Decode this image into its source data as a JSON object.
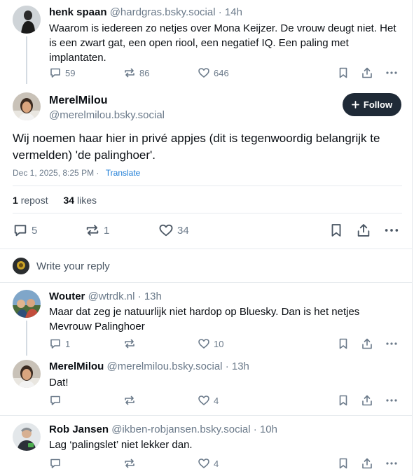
{
  "post1": {
    "name": "henk spaan",
    "handle": "@hardgras.bsky.social",
    "time": "14h",
    "text": "Waarom is iedereen zo netjes over Mona Keijzer. De vrouw deugt niet. Het is een zwart gat, een open riool, een negatief IQ. Een paling met implantaten.",
    "replies": "59",
    "reposts": "86",
    "likes": "646"
  },
  "main": {
    "name": "MerelMilou",
    "handle": "@merelmilou.bsky.social",
    "follow_label": "Follow",
    "text": "Wij noemen haar hier in privé appjes (dit is tegenwoordig belangrijk te vermelden) 'de palinghoer'.",
    "date": "Dec 1, 2025, 8:25 PM",
    "date_sep": "·",
    "translate": "Translate",
    "repost_count": "1",
    "repost_label": "repost",
    "like_count": "34",
    "like_label": "likes",
    "replies": "5",
    "reposts": "1",
    "likes": "34"
  },
  "reply_box": {
    "placeholder": "Write your reply"
  },
  "reply1": {
    "name": "Wouter",
    "handle": "@wtrdk.nl",
    "time": "13h",
    "text": "Maar dat zeg je natuurlijk niet hardop op Bluesky. Dan is het netjes Mevrouw Palinghoer",
    "replies": "1",
    "likes": "10"
  },
  "reply2": {
    "name": "MerelMilou",
    "handle": "@merelmilou.bsky.social",
    "time": "13h",
    "text": "Dat!",
    "likes": "4"
  },
  "reply3": {
    "name": "Rob Jansen",
    "handle": "@ikben-robjansen.bsky.social",
    "time": "10h",
    "text": "Lag ‘palingslet’ niet lekker dan.",
    "likes": "4"
  },
  "colors": {
    "accent": "#1c7cd6",
    "muted": "#6b7a8a",
    "follow_bg": "#1f2a37",
    "divider": "#e6eaee"
  },
  "icons": [
    "reply-icon",
    "repost-icon",
    "like-icon",
    "bookmark-icon",
    "share-icon",
    "more-icon",
    "plus-icon"
  ]
}
